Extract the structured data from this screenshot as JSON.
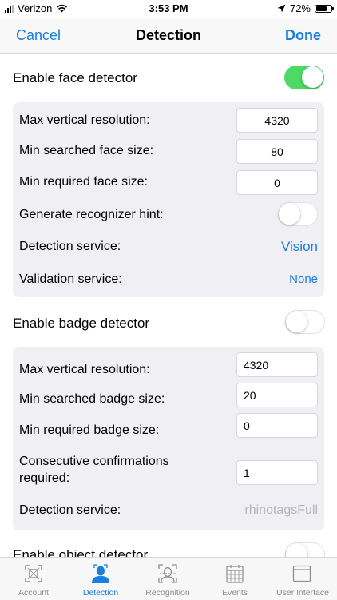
{
  "status_bar": {
    "carrier": "Verizon",
    "time": "3:53 PM",
    "battery": "72%",
    "battery_level": 0.72
  },
  "nav": {
    "cancel": "Cancel",
    "title": "Detection",
    "done": "Done"
  },
  "face": {
    "enable_label": "Enable face detector",
    "enabled": true,
    "max_vertical_label": "Max vertical resolution:",
    "max_vertical_value": "4320",
    "min_searched_label": "Min searched face size:",
    "min_searched_value": "80",
    "min_required_label": "Min required face size:",
    "min_required_value": "0",
    "hint_label": "Generate recognizer hint:",
    "hint_enabled": false,
    "detection_label": "Detection service:",
    "detection_value": "Vision",
    "validation_label": "Validation service:",
    "validation_value": "None"
  },
  "badge": {
    "enable_label": "Enable badge detector",
    "enabled": false,
    "max_vertical_label": "Max vertical resolution:",
    "max_vertical_value": "4320",
    "min_searched_label": "Min searched badge size:",
    "min_searched_value": "20",
    "min_required_label": "Min required badge size:",
    "min_required_value": "0",
    "consecutive_label_line1": "Consecutive confirmations",
    "consecutive_label_line2": "required:",
    "consecutive_value": "1",
    "detection_label": "Detection service:",
    "detection_value": "rhinotagsFull"
  },
  "object": {
    "enable_label": "Enable object detector",
    "enabled": false
  },
  "tabs": [
    {
      "label": "Account",
      "icon": "account-frame-icon",
      "active": false
    },
    {
      "label": "Detection",
      "icon": "person-icon",
      "active": true
    },
    {
      "label": "Recognition",
      "icon": "face-scan-icon",
      "active": false
    },
    {
      "label": "Events",
      "icon": "calendar-icon",
      "active": false
    },
    {
      "label": "User Interface",
      "icon": "window-icon",
      "active": false
    }
  ],
  "colors": {
    "accent": "#1a7de0",
    "toggle_on": "#4cd964",
    "panel": "#efeff4",
    "tab_inactive": "#8e8e93"
  }
}
